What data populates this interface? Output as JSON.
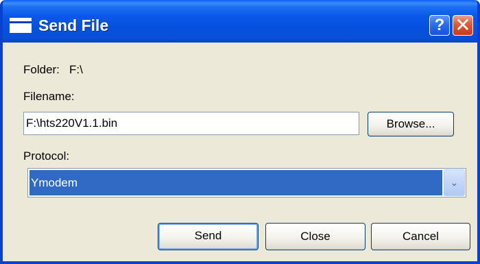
{
  "window": {
    "title": "Send File",
    "help_symbol": "?",
    "close_symbol": "✕"
  },
  "folder": {
    "label": "Folder:",
    "value": "F:\\"
  },
  "filename": {
    "label": "Filename:",
    "value": "F:\\hts220V1.1.bin",
    "browse_label": "Browse..."
  },
  "protocol": {
    "label": "Protocol:",
    "selected": "Ymodem",
    "arrow_symbol": "⌄"
  },
  "actions": {
    "send_label": "Send",
    "close_label": "Close",
    "cancel_label": "Cancel"
  },
  "colors": {
    "titlebar": "#0550dc",
    "dialog_bg": "#ece9d8",
    "selection": "#316ac5",
    "close_button": "#de5f3c"
  },
  "icons": {
    "title": "window-icon",
    "help": "help-icon",
    "close": "close-icon",
    "dropdown": "chevron-down-icon"
  }
}
